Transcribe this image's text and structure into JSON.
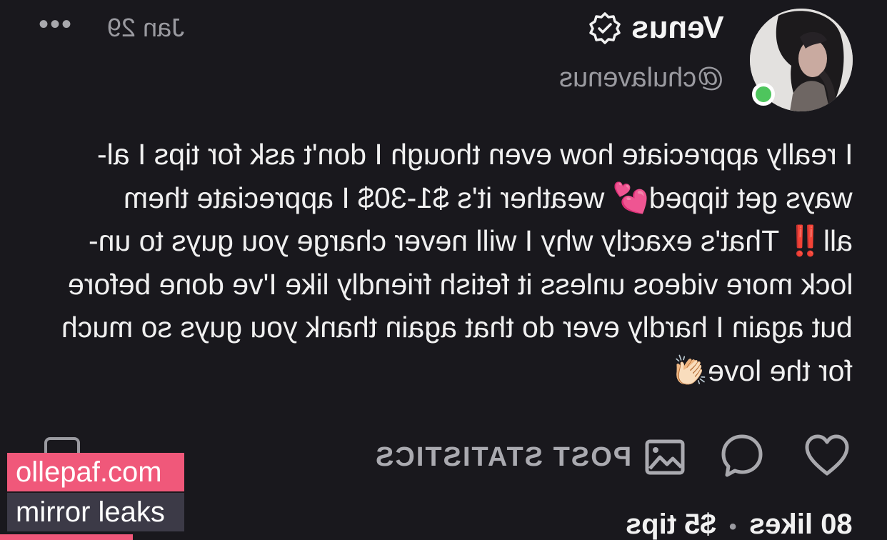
{
  "header": {
    "more_label": "•••",
    "date": "Jan 29",
    "author_name": "Venus",
    "author_handle": "@chulavenus"
  },
  "post": {
    "lines": [
      "I really appreciate how even though I don't ask for tips I al-",
      "ways get tipped💕 weather it's $1-30$ I appreciate them",
      "all‼️ That's exactly why I will never charge you guys to un-",
      "lock more videos unless it fetish friendly like I've done before",
      "but again I hardly ever do that again thank you guys so much",
      "for the love👏🏻"
    ]
  },
  "actions": {
    "like_icon": "heart-icon",
    "comment_icon": "comment-bubble-icon",
    "stats_icon": "image-chart-icon",
    "stats_label": "POST STATISTICS",
    "bookmark_icon": "bookmark-icon"
  },
  "stats": {
    "likes": "80 likes",
    "separator": "•",
    "tips": "$5 tips"
  },
  "watermark": {
    "site": "ollepaf.com",
    "tagline": "mirror leaks"
  },
  "colors": {
    "background": "#19181d",
    "online": "#4ec55d",
    "watermark_pink": "#f0587a",
    "watermark_dark": "#3c3a47"
  }
}
